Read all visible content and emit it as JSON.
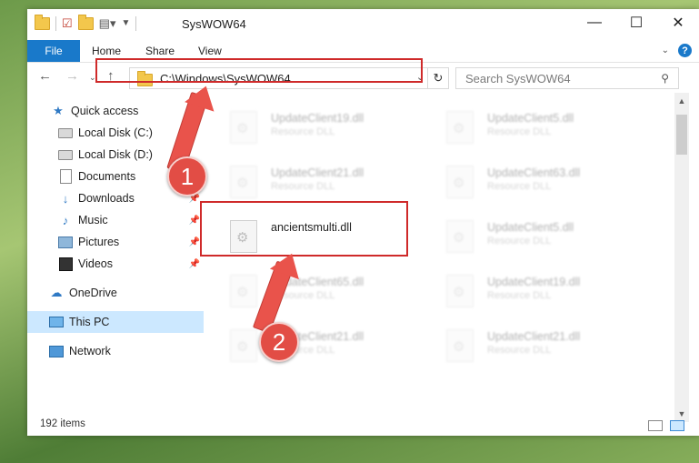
{
  "window": {
    "title": "SysWOW64",
    "buttons": {
      "minimize": "—",
      "maximize": "☐",
      "close": "✕"
    }
  },
  "ribbon": {
    "tabs": [
      "File",
      "Home",
      "Share",
      "View"
    ],
    "help": "?"
  },
  "address": {
    "path": "C:\\Windows\\SysWOW64",
    "search_placeholder": "Search SysWOW64"
  },
  "navpane": {
    "items": [
      {
        "label": "Quick access",
        "icon": "star-icon"
      },
      {
        "label": "Local Disk (C:)",
        "icon": "disk-icon"
      },
      {
        "label": "Local Disk (D:)",
        "icon": "disk-icon"
      },
      {
        "label": "Documents",
        "icon": "documents-icon"
      },
      {
        "label": "Downloads",
        "icon": "download-icon"
      },
      {
        "label": "Music",
        "icon": "music-icon"
      },
      {
        "label": "Pictures",
        "icon": "pictures-icon"
      },
      {
        "label": "Videos",
        "icon": "videos-icon"
      },
      {
        "label": "OneDrive",
        "icon": "cloud-icon"
      },
      {
        "label": "This PC",
        "icon": "computer-icon",
        "selected": true
      },
      {
        "label": "Network",
        "icon": "network-icon"
      }
    ]
  },
  "files": {
    "type": "Resource DLL",
    "highlighted": {
      "name": "ancientsmulti.dll"
    },
    "left_column": [
      "UpdateClient19.dll",
      "UpdateClient21.dll",
      "UpdateClient65.dll",
      "UpdateClient21.dll"
    ],
    "right_column": [
      "UpdateClient5.dll",
      "UpdateClient63.dll",
      "UpdateClient5.dll",
      "UpdateClient19.dll",
      "UpdateClient21.dll"
    ]
  },
  "status": {
    "item_count": "192 items"
  },
  "annotations": {
    "step1": "1",
    "step2": "2"
  },
  "colors": {
    "accent": "#1979ca",
    "highlight": "#cf2a2a",
    "selection": "#cce8ff"
  }
}
